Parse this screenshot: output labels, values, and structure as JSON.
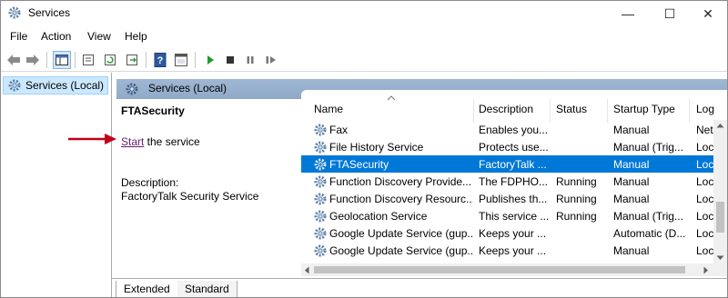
{
  "window": {
    "title": "Services",
    "minimize_glyph": "—",
    "maximize_glyph": "☐",
    "close_glyph": "✕"
  },
  "menu": [
    "File",
    "Action",
    "View",
    "Help"
  ],
  "tree": {
    "root_label": "Services (Local)"
  },
  "panel": {
    "header": "Services (Local)"
  },
  "detail": {
    "service_name": "FTASecurity",
    "start_link": "Start",
    "start_suffix": " the service",
    "description_label": "Description:",
    "description_text": "FactoryTalk Security Service"
  },
  "annotation": {
    "arrow_color": "#c0001a"
  },
  "table": {
    "columns": [
      "Name",
      "Description",
      "Status",
      "Startup Type",
      "Log"
    ],
    "rows": [
      {
        "name": "Fax",
        "description": "Enables you...",
        "status": "",
        "startup": "Manual",
        "logon": "Net"
      },
      {
        "name": "File History Service",
        "description": "Protects use...",
        "status": "",
        "startup": "Manual (Trig...",
        "logon": "Loc"
      },
      {
        "name": "FTASecurity",
        "description": "FactoryTalk ...",
        "status": "",
        "startup": "Manual",
        "logon": "Loc",
        "selected": true
      },
      {
        "name": "Function Discovery Provide...",
        "description": "The FDPHO...",
        "status": "Running",
        "startup": "Manual",
        "logon": "Loc"
      },
      {
        "name": "Function Discovery Resourc...",
        "description": "Publishes th...",
        "status": "Running",
        "startup": "Manual",
        "logon": "Loc"
      },
      {
        "name": "Geolocation Service",
        "description": "This service ...",
        "status": "Running",
        "startup": "Manual (Trig...",
        "logon": "Loc"
      },
      {
        "name": "Google Update Service (gup...",
        "description": "Keeps your ...",
        "status": "",
        "startup": "Automatic (D...",
        "logon": "Loc"
      },
      {
        "name": "Google Update Service (gup...",
        "description": "Keeps your ...",
        "status": "",
        "startup": "Manual",
        "logon": "Loc"
      }
    ]
  },
  "tabs": [
    "Extended",
    "Standard"
  ],
  "colors": {
    "selection": "#0078d7",
    "header_band": "#9fb7d3"
  }
}
